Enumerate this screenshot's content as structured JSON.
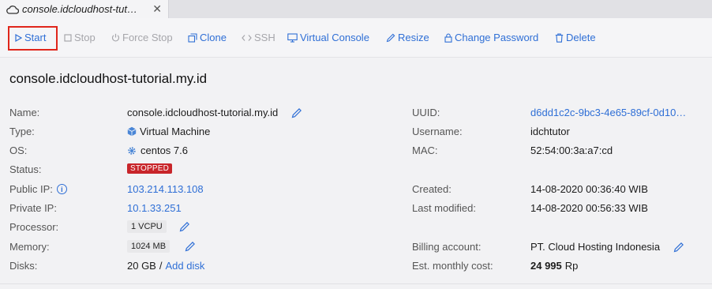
{
  "tab": {
    "title": "console.idcloudhost-tut…",
    "close": "✕"
  },
  "toolbar": {
    "start": "Start",
    "stop": "Stop",
    "force_stop": "Force Stop",
    "clone": "Clone",
    "ssh": "SSH",
    "virtual_console": "Virtual Console",
    "resize": "Resize",
    "change_password": "Change Password",
    "delete": "Delete"
  },
  "heading": "console.idcloudhost-tutorial.my.id",
  "left": {
    "name_label": "Name:",
    "name_value": "console.idcloudhost-tutorial.my.id",
    "type_label": "Type:",
    "type_value": "Virtual Machine",
    "os_label": "OS:",
    "os_value": "centos 7.6",
    "status_label": "Status:",
    "status_value": "STOPPED",
    "public_ip_label": "Public IP:",
    "public_ip_value": "103.214.113.108",
    "info_glyph": "i",
    "private_ip_label": "Private IP:",
    "private_ip_value": "10.1.33.251",
    "processor_label": "Processor:",
    "processor_value": "1 VCPU",
    "memory_label": "Memory:",
    "memory_value": "1024 MB",
    "disks_label": "Disks:",
    "disks_size": "20 GB",
    "disks_sep": "/",
    "add_disk": "Add disk"
  },
  "right": {
    "uuid_label": "UUID:",
    "uuid_value": "d6dd1c2c-9bc3-4e65-89cf-0d10…",
    "username_label": "Username:",
    "username_value": "idchtutor",
    "mac_label": "MAC:",
    "mac_value": "52:54:00:3a:a7:cd",
    "created_label": "Created:",
    "created_value": "14-08-2020 00:36:40 WIB",
    "modified_label": "Last modified:",
    "modified_value": "14-08-2020 00:56:33 WIB",
    "billing_label": "Billing account:",
    "billing_value": "PT. Cloud Hosting Indonesia",
    "cost_label": "Est. monthly cost:",
    "cost_amount": "24 995",
    "cost_currency": "Rp"
  },
  "colors": {
    "accent": "#2f6fd6",
    "disabled": "#a6a6ab",
    "stopped": "#c8252a",
    "highlight_box": "#e0261b"
  },
  "icons": [
    "cloud-icon",
    "close-icon",
    "play-icon",
    "stop-icon",
    "power-icon",
    "clone-icon",
    "code-icon",
    "monitor-icon",
    "pencil-icon",
    "lock-icon",
    "trash-icon",
    "cube-icon",
    "gear-icon",
    "info-icon"
  ]
}
